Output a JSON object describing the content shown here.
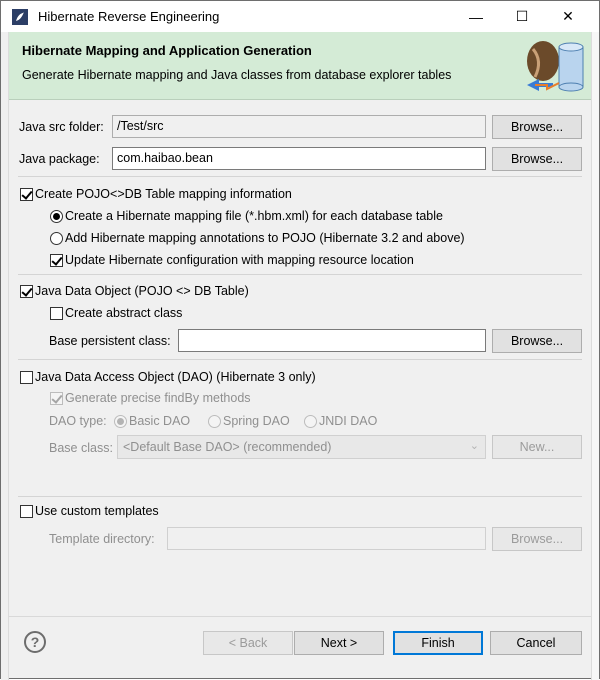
{
  "window": {
    "title": "Hibernate Reverse Engineering",
    "minimize_glyph": "—",
    "maximize_glyph": "☐",
    "close_glyph": "✕"
  },
  "banner": {
    "title": "Hibernate Mapping and Application Generation",
    "subtitle": "Generate Hibernate mapping and Java classes from database explorer tables",
    "icon": "hibernate-database-icon"
  },
  "form": {
    "java_src_folder": {
      "label": "Java src folder:",
      "value": "/Test/src",
      "browse": "Browse..."
    },
    "java_package": {
      "label": "Java package:",
      "value": "com.haibao.bean",
      "browse": "Browse..."
    }
  },
  "pojo_mapping": {
    "label": "Create POJO<>DB Table mapping information",
    "checked": true,
    "options": {
      "hbm_file": {
        "label": "Create a Hibernate mapping file (*.hbm.xml) for each database table",
        "selected": true
      },
      "annotations": {
        "label": "Add Hibernate mapping annotations to POJO (Hibernate 3.2 and above)",
        "selected": false
      }
    },
    "update_config": {
      "label": "Update Hibernate configuration with mapping resource location",
      "checked": true
    }
  },
  "java_data_object": {
    "label": "Java Data Object (POJO <> DB Table)",
    "checked": true,
    "abstract_class": {
      "label": "Create abstract class",
      "checked": false
    },
    "base_persistent": {
      "label": "Base persistent class:",
      "value": "",
      "browse": "Browse..."
    }
  },
  "dao": {
    "label": "Java Data Access Object (DAO) (Hibernate 3 only)",
    "checked": false,
    "findby": {
      "label": "Generate precise findBy methods",
      "checked": true
    },
    "type_label": "DAO type:",
    "types": [
      {
        "label": "Basic DAO",
        "selected": true
      },
      {
        "label": "Spring DAO",
        "selected": false
      },
      {
        "label": "JNDI DAO",
        "selected": false
      }
    ],
    "base_class_label": "Base class:",
    "base_class_value": "<Default Base DAO> (recommended)",
    "new_button": "New..."
  },
  "templates": {
    "label": "Use custom templates",
    "checked": false,
    "dir_label": "Template directory:",
    "dir_value": "",
    "browse": "Browse..."
  },
  "footer": {
    "help": "?",
    "back": "< Back",
    "next": "Next >",
    "finish": "Finish",
    "cancel": "Cancel"
  }
}
